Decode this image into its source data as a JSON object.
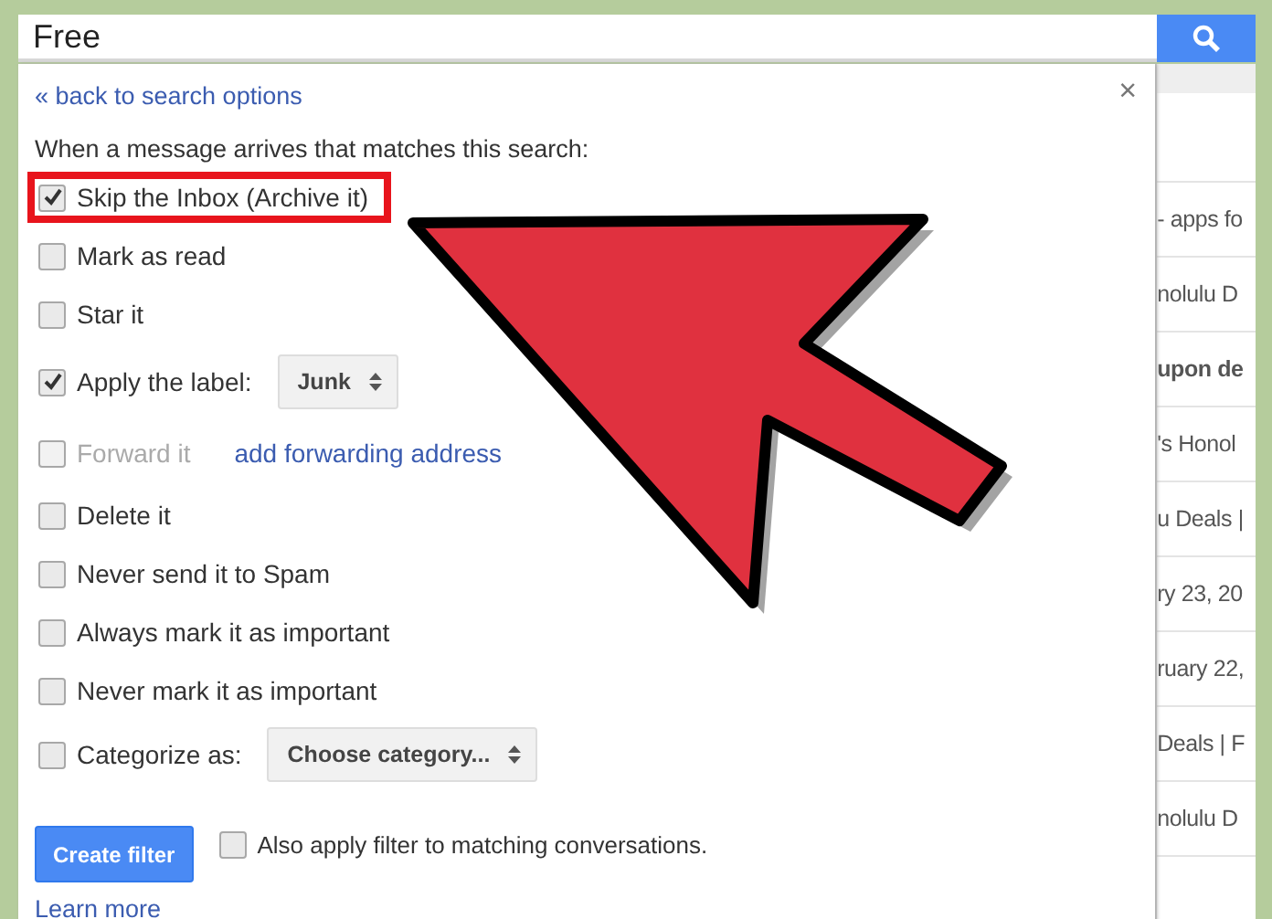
{
  "search": {
    "value": "Free"
  },
  "filter_dialog": {
    "back_link": "« back to search options",
    "close": "×",
    "intro": "When a message arrives that matches this search:",
    "options": [
      {
        "kind": "checkbox",
        "label": "Skip the Inbox (Archive it)",
        "checked": true,
        "disabled": false,
        "highlighted": true
      },
      {
        "kind": "checkbox",
        "label": "Mark as read",
        "checked": false,
        "disabled": false,
        "highlighted": false
      },
      {
        "kind": "checkbox",
        "label": "Star it",
        "checked": false,
        "disabled": false,
        "highlighted": false
      },
      {
        "kind": "select",
        "label": "Apply the label:",
        "checked": true,
        "disabled": false,
        "highlighted": false,
        "select_value": "Junk"
      },
      {
        "kind": "link",
        "label": "Forward it",
        "checked": false,
        "disabled": true,
        "highlighted": false,
        "link": "add forwarding address"
      },
      {
        "kind": "checkbox",
        "label": "Delete it",
        "checked": false,
        "disabled": false,
        "highlighted": false
      },
      {
        "kind": "checkbox",
        "label": "Never send it to Spam",
        "checked": false,
        "disabled": false,
        "highlighted": false
      },
      {
        "kind": "checkbox",
        "label": "Always mark it as important",
        "checked": false,
        "disabled": false,
        "highlighted": false
      },
      {
        "kind": "checkbox",
        "label": "Never mark it as important",
        "checked": false,
        "disabled": false,
        "highlighted": false
      },
      {
        "kind": "select",
        "label": "Categorize as:",
        "checked": false,
        "disabled": false,
        "highlighted": false,
        "select_value": "Choose category..."
      }
    ],
    "create_button": "Create filter",
    "also_apply": {
      "label": "Also apply filter to matching conversations.",
      "checked": false
    },
    "learn_more": "Learn more"
  },
  "message_list": [
    "- apps fo",
    "nolulu D",
    "upon de",
    "'s Honol",
    "u Deals |",
    "ry 23, 20",
    "ruary 22,",
    "Deals | F",
    "nolulu D"
  ],
  "message_bold": [
    false,
    false,
    true,
    false,
    false,
    false,
    false,
    false,
    false
  ]
}
